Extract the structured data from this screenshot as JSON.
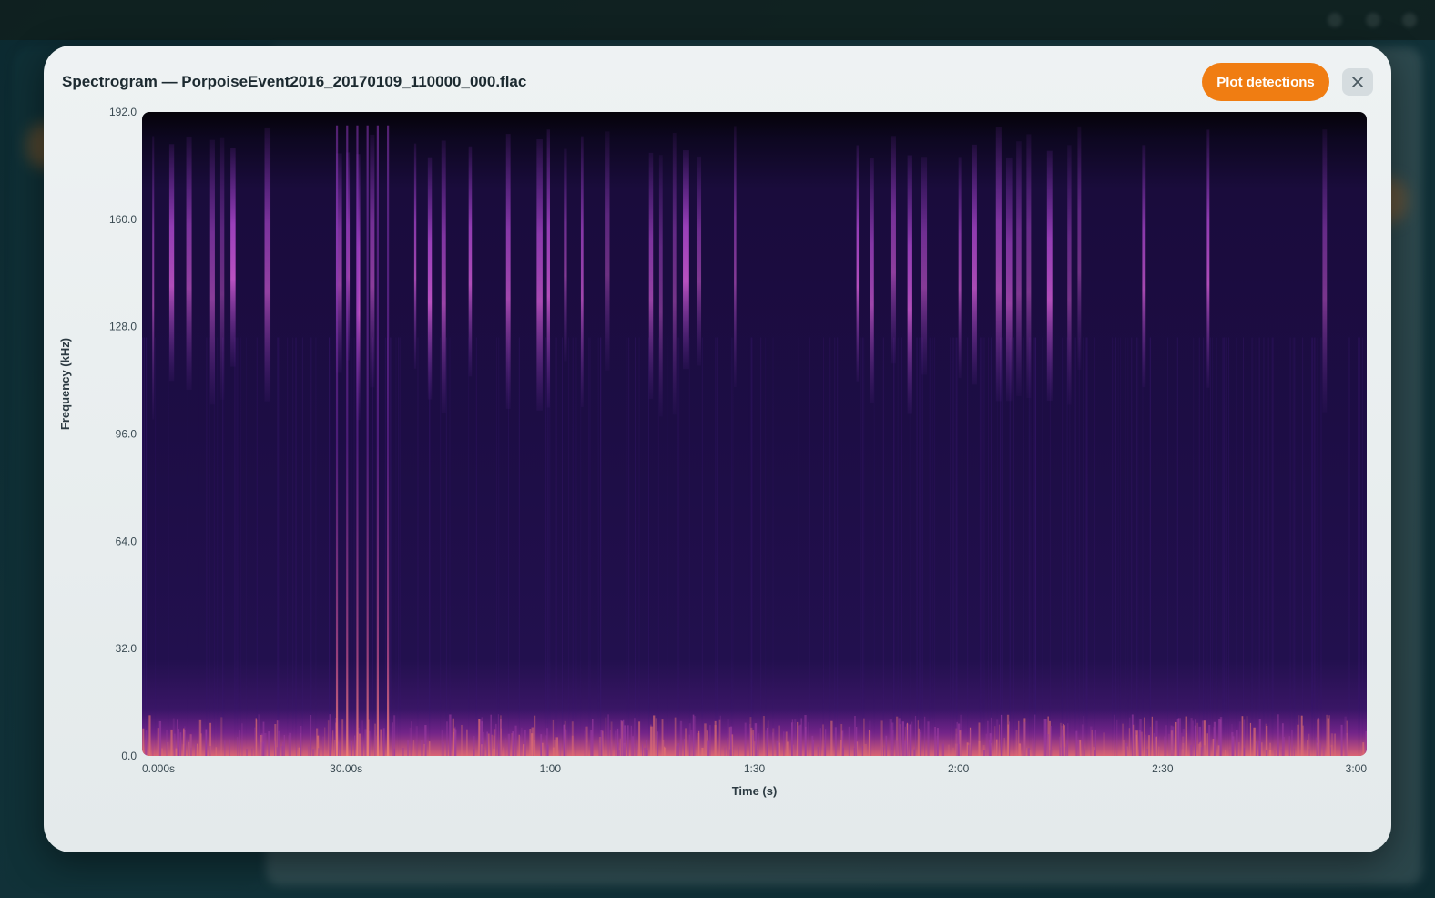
{
  "modal": {
    "title": "Spectrogram — PorpoiseEvent2016_20170109_110000_000.flac",
    "plot_button_label": "Plot detections",
    "close_icon": "close-icon"
  },
  "colors": {
    "accent": "#f07d12",
    "spectrogram_background": "#1d0d45",
    "spectrogram_top": "#060410",
    "spectrogram_energy": "#a03ec8",
    "spectrogram_hot": "#f07a6a"
  },
  "chart_data": {
    "type": "heatmap",
    "title": "",
    "xlabel": "Time (s)",
    "ylabel": "Frequency (kHz)",
    "xlim": [
      0,
      180
    ],
    "ylim": [
      0,
      192
    ],
    "x_ticks": [
      {
        "value": 0,
        "label": "0.000s"
      },
      {
        "value": 30,
        "label": "30.00s"
      },
      {
        "value": 60,
        "label": "1:00"
      },
      {
        "value": 90,
        "label": "1:30"
      },
      {
        "value": 120,
        "label": "2:00"
      },
      {
        "value": 150,
        "label": "2:30"
      },
      {
        "value": 180,
        "label": "3:00"
      }
    ],
    "y_ticks": [
      {
        "value": 0,
        "label": "0.0"
      },
      {
        "value": 32,
        "label": "32.0"
      },
      {
        "value": 64,
        "label": "64.0"
      },
      {
        "value": 96,
        "label": "96.0"
      },
      {
        "value": 128,
        "label": "128.0"
      },
      {
        "value": 160,
        "label": "160.0"
      },
      {
        "value": 192,
        "label": "192.0"
      }
    ],
    "grid": false,
    "legend": "none"
  }
}
